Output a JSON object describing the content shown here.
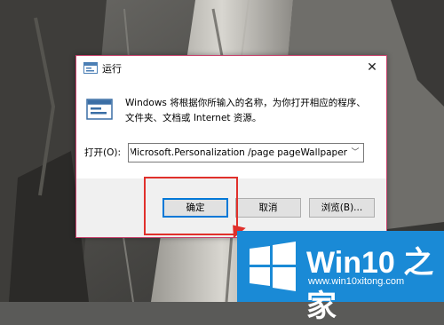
{
  "dialog": {
    "title": "运行",
    "close_label": "✕",
    "description_line1": "Windows 将根据你所输入的名称，为你打开相应的程序、",
    "description_line2": "文件夹、文档或 Internet 资源。",
    "open_label": "打开(O):",
    "open_value": "e Microsoft.Personalization /page pageWallpaper",
    "buttons": {
      "ok": "确定",
      "cancel": "取消",
      "browse": "浏览(B)..."
    }
  },
  "watermark": {
    "title": "Win10 之家",
    "url": "www.win10xitong.com"
  },
  "colors": {
    "highlight": "#e0302b",
    "logo_bg": "#1a8ad6",
    "dialog_border": "#c9426d"
  }
}
